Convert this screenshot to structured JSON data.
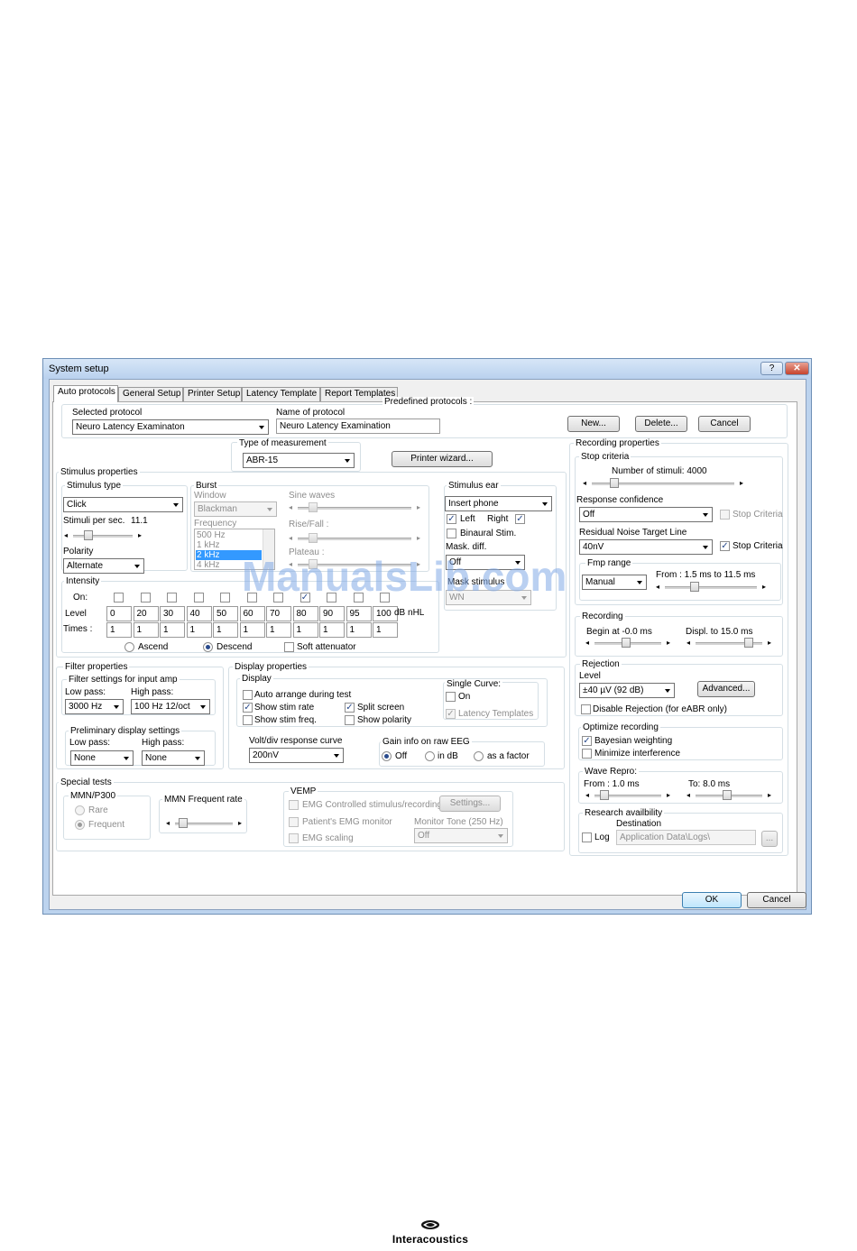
{
  "window": {
    "title": "System setup",
    "help_btn": "?",
    "close_btn": "✕"
  },
  "tabs": [
    {
      "label": "Auto protocols"
    },
    {
      "label": "General Setup"
    },
    {
      "label": "Printer Setup"
    },
    {
      "label": "Latency Template"
    },
    {
      "label": "Report Templates"
    }
  ],
  "protocol": {
    "predefined_label": "Predefined protocols :",
    "selected_label": "Selected protocol",
    "selected_value": "Neuro Latency Examinaton",
    "name_label": "Name of protocol",
    "name_value": "Neuro Latency Examination",
    "new_btn": "New...",
    "delete_btn": "Delete...",
    "cancel_btn": "Cancel"
  },
  "measurement": {
    "label": "Type of measurement",
    "value": "ABR-15",
    "printer_wizard_btn": "Printer wizard..."
  },
  "stimulus": {
    "group_label": "Stimulus properties",
    "type_label": "Stimulus type",
    "type_value": "Click",
    "rate_label": "Stimuli per sec.",
    "rate_value": "11.1",
    "polarity_label": "Polarity",
    "polarity_value": "Alternate",
    "burst": {
      "label": "Burst",
      "window_label": "Window",
      "window_value": "Blackman",
      "sine_label": "Sine waves",
      "frequency_label": "Frequency",
      "frequencies": [
        "500 Hz",
        "1 kHz",
        "2 kHz",
        "4 kHz"
      ],
      "rise_label": "Rise/Fall :",
      "plateau_label": "Plateau :"
    },
    "ear": {
      "label": "Stimulus ear",
      "transducer": "Insert phone",
      "left_label": "Left",
      "right_label": "Right",
      "binaural_label": "Binaural Stim.",
      "mask_label": "Mask. diff.",
      "mask_value": "Off",
      "mask_stim_label": "Mask stimulus",
      "mask_stim_value": "WN"
    },
    "intensity": {
      "label": "Intensity",
      "on_label": "On:",
      "level_label": "Level",
      "times_label": "Times :",
      "unit": "dB nHL",
      "levels": [
        "0",
        "20",
        "30",
        "40",
        "50",
        "60",
        "70",
        "80",
        "90",
        "95",
        "100"
      ],
      "times": [
        "1",
        "1",
        "1",
        "1",
        "1",
        "1",
        "1",
        "1",
        "1",
        "1",
        "1"
      ],
      "ascend_label": "Ascend",
      "descend_label": "Descend",
      "soft_label": "Soft attenuator"
    }
  },
  "filter": {
    "group_label": "Filter properties",
    "amp_label": "Filter settings for input amp",
    "low_label": "Low pass:",
    "low_value": "3000 Hz",
    "high_label": "High pass:",
    "high_value": "100 Hz 12/oct",
    "prelim_label": "Preliminary display settings",
    "pre_low_label": "Low pass:",
    "pre_low_value": "None",
    "pre_high_label": "High pass:",
    "pre_high_value": "None"
  },
  "display": {
    "group_label": "Display properties",
    "sub_label": "Display",
    "auto_arrange": "Auto arrange during test",
    "show_stim_rate": "Show stim rate",
    "show_stim_freq": "Show stim freq.",
    "split_screen": "Split screen",
    "show_polarity": "Show polarity",
    "single_curve_label": "Single Curve:",
    "on_label": "On",
    "latency_templates": "Latency Templates",
    "volt_label": "Volt/div response curve",
    "volt_value": "200nV",
    "gain_label": "Gain info on raw EEG",
    "gain_off": "Off",
    "gain_db": "in dB",
    "gain_factor": "as a factor"
  },
  "special": {
    "label": "Special tests",
    "mmn_label": "MMN/P300",
    "rare": "Rare",
    "frequent": "Frequent",
    "mmn_rate_label": "MMN Frequent rate",
    "vemp_label": "VEMP",
    "emg_controlled": "EMG Controlled stimulus/recording",
    "settings_btn": "Settings...",
    "emg_monitor": "Patient's EMG monitor",
    "monitor_tone_label": "Monitor Tone (250 Hz)",
    "monitor_tone_value": "Off",
    "emg_scaling": "EMG scaling"
  },
  "recording_props": {
    "label": "Recording properties",
    "stop": {
      "label": "Stop criteria",
      "num_stimuli": "Number of stimuli: 4000",
      "resp_conf_label": "Response confidence",
      "resp_conf_value": "Off",
      "stop_criteria": "Stop Criteria",
      "residual_label": "Residual Noise Target Line",
      "residual_value": "40nV",
      "fmp_label": "Fmp range",
      "fmp_value": "Manual",
      "fmp_range": "From : 1.5 ms to 11.5 ms"
    },
    "recording": {
      "label": "Recording",
      "begin": "Begin at  -0.0 ms",
      "displ": "Displ. to   15.0 ms"
    },
    "rejection": {
      "label": "Rejection",
      "level_label": "Level",
      "level_value": "±40 µV (92 dB)",
      "advanced_btn": "Advanced...",
      "disable": "Disable Rejection (for eABR only)"
    },
    "optimize": {
      "label": "Optimize recording",
      "bayesian": "Bayesian weighting",
      "minimize": "Minimize interference"
    },
    "wave": {
      "label": "Wave Repro:",
      "from": "From :  1.0 ms",
      "to": "To:   8.0 ms"
    },
    "research": {
      "label": "Research availbility",
      "dest_label": "Destination",
      "log_label": "Log",
      "dest_value": "Application Data\\Logs\\",
      "browse_btn": "..."
    }
  },
  "footer": {
    "ok_btn": "OK",
    "cancel_btn": "Cancel"
  },
  "watermark": "ManualsLib.com",
  "brand": "Interacoustics"
}
